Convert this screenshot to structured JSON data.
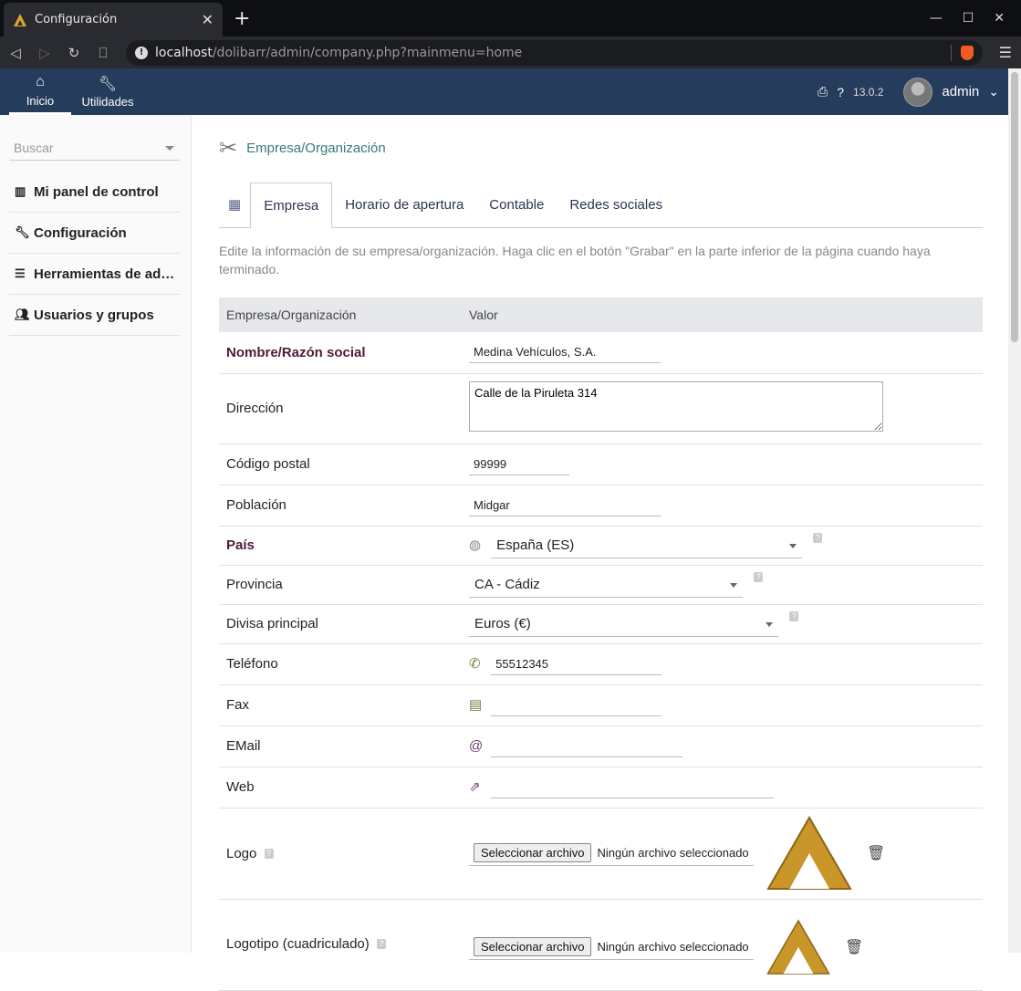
{
  "browser": {
    "tab_title": "Configuración",
    "tab_close": "✕",
    "new_tab": "+",
    "url_host": "localhost",
    "url_path": "/dolibarr/admin/company.php?mainmenu=home"
  },
  "topmenu": {
    "home_label": "Inicio",
    "utils_label": "Utilidades",
    "version": "13.0.2",
    "user": "admin"
  },
  "sidebar": {
    "search_placeholder": "Buscar",
    "items": [
      {
        "label": "Mi panel de control"
      },
      {
        "label": "Configuración"
      },
      {
        "label": "Herramientas de ad…"
      },
      {
        "label": "Usuarios y grupos"
      }
    ]
  },
  "page": {
    "title": "Empresa/Organización",
    "tabs": [
      {
        "label": "Empresa"
      },
      {
        "label": "Horario de apertura"
      },
      {
        "label": "Contable"
      },
      {
        "label": "Redes sociales"
      }
    ],
    "intro": "Edite la información de su empresa/organización. Haga clic en el botón \"Grabar\" en la parte inferior de la página cuando haya terminado."
  },
  "table": {
    "col1": "Empresa/Organización",
    "col2": "Valor",
    "name_label": "Nombre/Razón social",
    "name_value": "Medina Vehículos, S.A.",
    "address_label": "Dirección",
    "address_value": "Calle de la Piruleta 314",
    "zip_label": "Código postal",
    "zip_value": "99999",
    "town_label": "Población",
    "town_value": "Midgar",
    "country_label": "País",
    "country_value": "España (ES)",
    "state_label": "Provincia",
    "state_value": "CA - Cádiz",
    "currency_label": "Divisa principal",
    "currency_value": "Euros (€)",
    "phone_label": "Teléfono",
    "phone_value": "55512345",
    "fax_label": "Fax",
    "fax_value": "",
    "email_label": "EMail",
    "email_value": "",
    "web_label": "Web",
    "web_value": "",
    "logo_label": "Logo",
    "logo_sq_label": "Logotipo (cuadriculado)",
    "file_button": "Seleccionar archivo",
    "file_none": "Ningún archivo seleccionado"
  }
}
